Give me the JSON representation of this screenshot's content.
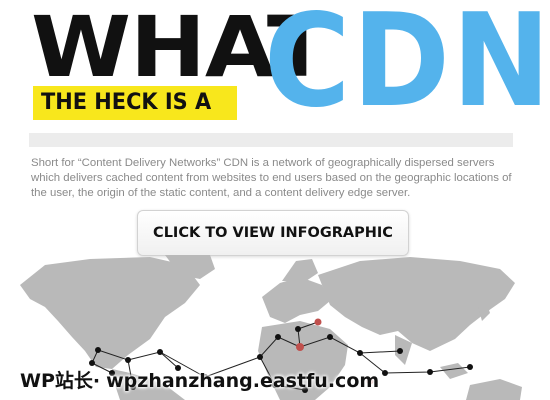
{
  "header": {
    "what": "WHAT",
    "heck": "THE HECK IS A",
    "cdn": "CDN"
  },
  "description": "Short for “Content Delivery Networks” CDN is a network of geographically dispersed servers which delivers cached content from websites to end users based on the geographic locations of the user, the origin of the static content, and a content delivery edge server.",
  "cta_label": "CLICK TO VIEW INFOGRAPHIC",
  "watermark": {
    "brand": "WP站长·",
    "url": "wpzhanzhang.eastfu.com"
  },
  "colors": {
    "accent_blue": "#54b3ec",
    "highlight_yellow": "#f8e71c",
    "map_gray": "#b9b9b9",
    "server_node": "#111111",
    "origin_node": "#c0504d"
  }
}
